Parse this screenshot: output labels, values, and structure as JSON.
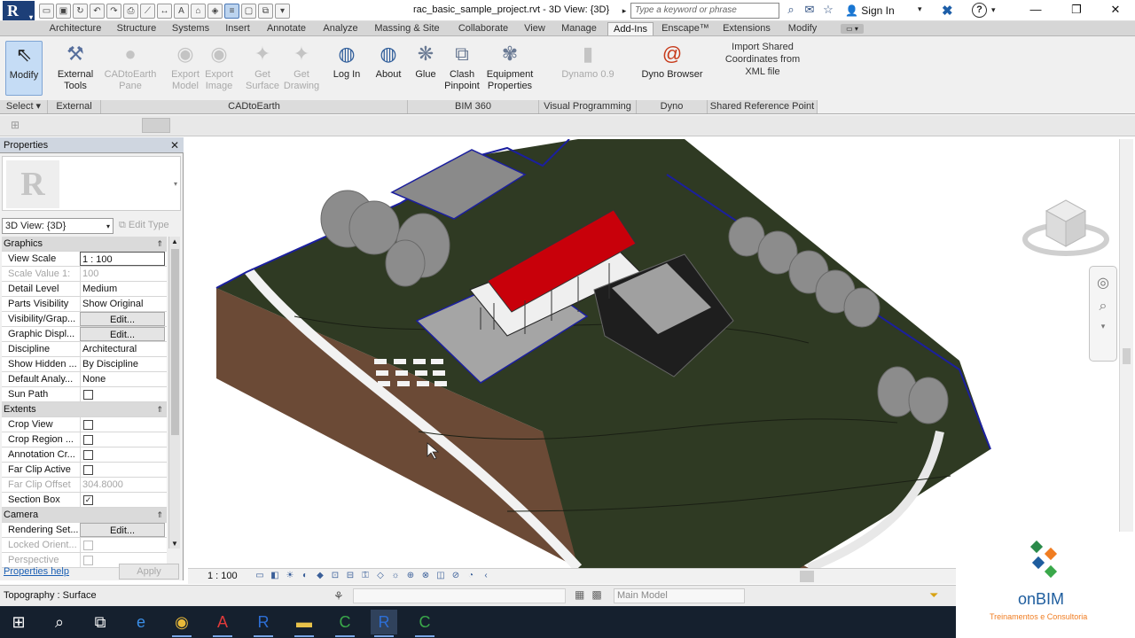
{
  "title_bar": {
    "app_logo": "R",
    "document_title": "rac_basic_sample_project.rvt - 3D View: {3D}",
    "search_placeholder": "Type a keyword or phrase",
    "sign_in": "Sign In",
    "help_symbol": "?"
  },
  "menu_tabs": [
    "Architecture",
    "Structure",
    "Systems",
    "Insert",
    "Annotate",
    "Analyze",
    "Massing & Site",
    "Collaborate",
    "View",
    "Manage",
    "Add-Ins",
    "Enscape™",
    "Extensions",
    "Modify"
  ],
  "active_tab": "Add-Ins",
  "ribbon": {
    "buttons": [
      {
        "id": "modify",
        "label": "Modify",
        "icon": "cursor-arrow-icon",
        "enabled": true,
        "selected": true
      },
      {
        "id": "external-tools",
        "label": "External Tools",
        "icon": "hammer-wrench-icon",
        "enabled": true
      },
      {
        "id": "cadtoearth-pane",
        "label": "CADtoEarth Pane",
        "icon": "globe-icon",
        "enabled": false
      },
      {
        "id": "export-model",
        "label": "Export Model",
        "icon": "globe-export-icon",
        "enabled": false
      },
      {
        "id": "export-image",
        "label": "Export Image",
        "icon": "globe-image-icon",
        "enabled": false
      },
      {
        "id": "get-surface",
        "label": "Get Surface",
        "icon": "surface-icon",
        "enabled": false
      },
      {
        "id": "get-drawing",
        "label": "Get Drawing",
        "icon": "drawing-icon",
        "enabled": false
      },
      {
        "id": "log-in",
        "label": "Log In",
        "icon": "login-icon",
        "enabled": true
      },
      {
        "id": "about",
        "label": "About",
        "icon": "info-globe-icon",
        "enabled": true
      },
      {
        "id": "glue",
        "label": "Glue",
        "icon": "glue-icon",
        "enabled": true
      },
      {
        "id": "clash-pinpoint",
        "label": "Clash Pinpoint",
        "icon": "clash-icon",
        "enabled": true
      },
      {
        "id": "equipment-properties",
        "label": "Equipment Properties",
        "icon": "equipment-icon",
        "enabled": true
      },
      {
        "id": "dynamo",
        "label": "Dynamo 0.9",
        "icon": "dynamo-icon",
        "enabled": false
      },
      {
        "id": "dyno-browser",
        "label": "Dyno Browser",
        "icon": "dyno-spiral-icon",
        "enabled": true
      }
    ],
    "shared_coordinates_text": "Import Shared Coordinates from XML file",
    "panels": [
      "Select",
      "External",
      "CADtoEarth",
      "BIM 360",
      "Visual Programming",
      "Dyno",
      "Shared Reference Point"
    ]
  },
  "properties": {
    "title": "Properties",
    "type_selector": "3D View: {3D}",
    "edit_type": "Edit Type",
    "rows": [
      {
        "kind": "group",
        "name": "Graphics"
      },
      {
        "name": "View Scale",
        "value": "1 : 100",
        "style": "box"
      },
      {
        "name": "Scale Value    1:",
        "value": "100",
        "disabled": true
      },
      {
        "name": "Detail Level",
        "value": "Medium"
      },
      {
        "name": "Parts Visibility",
        "value": "Show Original"
      },
      {
        "name": "Visibility/Grap...",
        "value": "Edit...",
        "style": "button"
      },
      {
        "name": "Graphic Displ...",
        "value": "Edit...",
        "style": "button"
      },
      {
        "name": "Discipline",
        "value": "Architectural"
      },
      {
        "name": "Show Hidden ...",
        "value": "By Discipline"
      },
      {
        "name": "Default Analy...",
        "value": "None"
      },
      {
        "name": "Sun Path",
        "check": false
      },
      {
        "kind": "group",
        "name": "Extents"
      },
      {
        "name": "Crop View",
        "check": false
      },
      {
        "name": "Crop Region ...",
        "check": false
      },
      {
        "name": "Annotation Cr...",
        "check": false
      },
      {
        "name": "Far Clip Active",
        "check": false
      },
      {
        "name": "Far Clip Offset",
        "value": "304.8000",
        "disabled": true
      },
      {
        "name": "Section Box",
        "check": true
      },
      {
        "kind": "group",
        "name": "Camera"
      },
      {
        "name": "Rendering Set...",
        "value": "Edit...",
        "style": "button"
      },
      {
        "name": "Locked Orient...",
        "check": false,
        "disabled": true
      },
      {
        "name": "Perspective",
        "check": false,
        "disabled": true
      }
    ],
    "help_link": "Properties help",
    "apply": "Apply"
  },
  "view_bar": {
    "scale": "1 : 100"
  },
  "status_bar": {
    "text": "Topography : Surface",
    "workset": "Main Model"
  },
  "taskbar": [
    {
      "name": "start",
      "icon": "windows-logo-icon"
    },
    {
      "name": "search",
      "icon": "search-icon"
    },
    {
      "name": "task-view",
      "icon": "task-view-icon"
    },
    {
      "name": "edge",
      "icon": "edge-icon"
    },
    {
      "name": "chrome",
      "icon": "chrome-icon"
    },
    {
      "name": "autocad",
      "icon": "autocad-icon"
    },
    {
      "name": "revit",
      "icon": "revit-icon"
    },
    {
      "name": "file-explorer",
      "icon": "folder-icon"
    },
    {
      "name": "camtasia",
      "icon": "camtasia-icon"
    },
    {
      "name": "revit-active",
      "icon": "revit-icon"
    },
    {
      "name": "camtasia-recorder",
      "icon": "camtasia-icon"
    }
  ],
  "watermark": {
    "name": "onBIM",
    "tagline": "Treinamentos e Consultoria"
  },
  "colors": {
    "roof": "#c8000a",
    "terrain": "#2f3a23",
    "section_edge": "#1b1f9e",
    "accent_blue": "#1d3f78"
  }
}
